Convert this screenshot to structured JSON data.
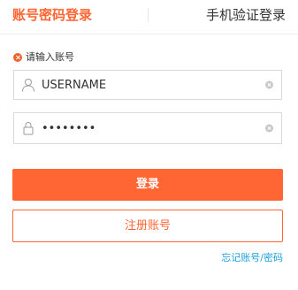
{
  "tabs": {
    "account_login": "账号密码登录",
    "phone_login": "手机验证登录"
  },
  "error": {
    "message": "请输入账号"
  },
  "username": {
    "value": "USERNAME"
  },
  "password": {
    "value": "••••••••"
  },
  "buttons": {
    "login": "登录",
    "register": "注册账号"
  },
  "links": {
    "forgot": "忘记账号/密码"
  },
  "colors": {
    "accent": "#ff6633",
    "link": "#1a9fd9",
    "error": "#f0602c"
  },
  "icons": {
    "username": "user-icon",
    "password": "lock-icon",
    "clear": "clear-icon",
    "error": "error-icon"
  }
}
